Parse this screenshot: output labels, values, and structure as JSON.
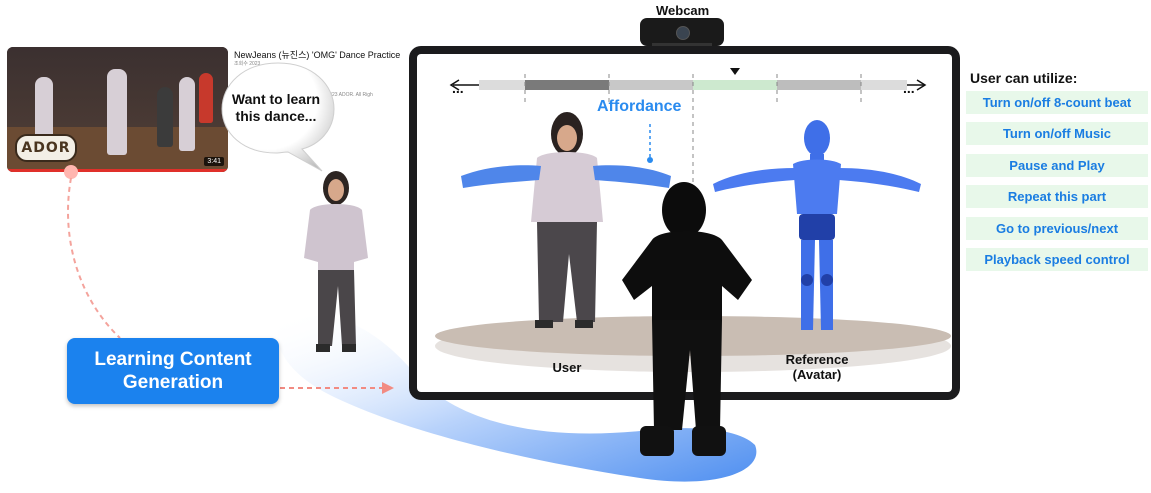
{
  "video": {
    "title": "NewJeans (뉴진스) 'OMG' Dance Practice",
    "meta": "조회수 2023",
    "copyright": "ⓒ 2023 ADOR. All Righ",
    "duration": "3:41",
    "logo_text": "ADOR"
  },
  "speech_bubble": {
    "text": "Want to learn this dance..."
  },
  "webcam": {
    "label": "Webcam"
  },
  "screen": {
    "affordance_label": "Affordance",
    "timeline_left_ellipsis": "...",
    "timeline_right_ellipsis": "...",
    "user_label": "User",
    "reference_label_line1": "Reference",
    "reference_label_line2": "(Avatar)"
  },
  "panel": {
    "title": "User can utilize:",
    "options": [
      "Turn on/off 8-count beat",
      "Turn on/off Music",
      "Pause and Play",
      "Repeat this part",
      "Go to previous/next",
      "Playback speed control"
    ]
  },
  "learning_content": {
    "line1": "Learning Content",
    "line2": "Generation"
  },
  "colors": {
    "accent_blue": "#1b82ee",
    "option_bg": "#e8f8ea",
    "option_text": "#1a7de2",
    "avatar_blue": "#3f6fe8",
    "affordance_blue": "#2a8bef",
    "dashed_pink": "#f28b82"
  }
}
